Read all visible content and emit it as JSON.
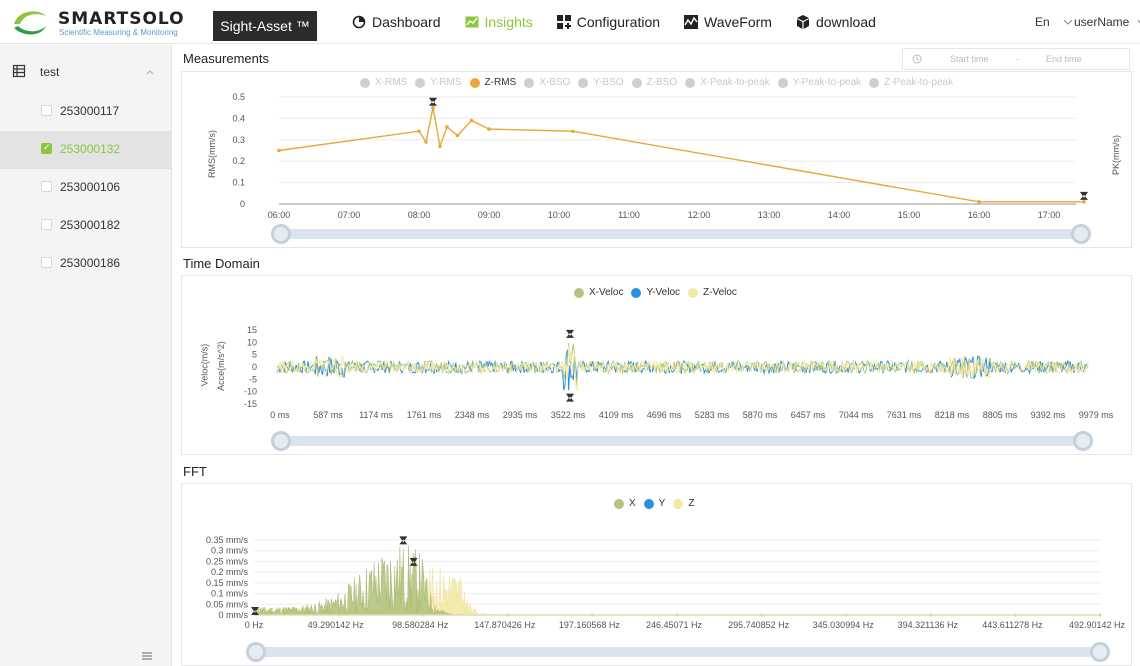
{
  "header": {
    "brand": "SMARTSOLO",
    "tagline": "Scientific Measuring & Monitoring",
    "product": "Sight-Asset ™",
    "nav": [
      {
        "label": "Dashboard",
        "icon": "pie-chart-icon"
      },
      {
        "label": "Insights",
        "icon": "area-chart-icon",
        "active": true
      },
      {
        "label": "Configuration",
        "icon": "grid-icon"
      },
      {
        "label": "WaveForm",
        "icon": "waveform-icon"
      },
      {
        "label": "download",
        "icon": "cube-icon"
      }
    ],
    "language": "En",
    "username": "userName"
  },
  "sidebar": {
    "group_label": "test",
    "devices": [
      {
        "label": "253000117",
        "checked": false
      },
      {
        "label": "253000132",
        "checked": true
      },
      {
        "label": "253000106",
        "checked": false
      },
      {
        "label": "253000182",
        "checked": false
      },
      {
        "label": "253000186",
        "checked": false
      }
    ]
  },
  "colors": {
    "accent": "#8cc63f",
    "zrms": "#e8a83a",
    "x": "#b4c37f",
    "y": "#2b8fe0",
    "z": "#f3e9a6"
  },
  "measurements": {
    "title": "Measurements",
    "start_placeholder": "Start time",
    "end_placeholder": "End time",
    "range_separator": "-",
    "legend": [
      "X-RMS",
      "Y-RMS",
      "Z-RMS",
      "X-BSO",
      "Y-BSO",
      "Z-BSO",
      "X-Peak-to-peak",
      "Y-Peak-to-peak",
      "Z-Peak-to-peak"
    ],
    "legend_active": "Z-RMS",
    "ylabel_left": "RMS(mm/s)",
    "ylabel_right": "PK(mm/s)"
  },
  "time_domain": {
    "title": "Time Domain",
    "legend": [
      "X-Veloc",
      "Y-Veloc",
      "Z-Veloc"
    ],
    "ylabel1": "Veloc(m/s)",
    "ylabel2": "Acce(m/s^2)"
  },
  "fft": {
    "title": "FFT",
    "legend": [
      "X",
      "Y",
      "Z"
    ]
  },
  "chart_data": [
    {
      "type": "line",
      "title": "Measurements",
      "ylabel": "RMS(mm/s)",
      "ylabel_right": "PK(mm/s)",
      "x_ticks": [
        "06:00",
        "07:00",
        "08:00",
        "09:00",
        "10:00",
        "11:00",
        "12:00",
        "13:00",
        "14:00",
        "15:00",
        "16:00",
        "17:00"
      ],
      "y_ticks": [
        "0",
        "0.1",
        "0.2",
        "0.3",
        "0.4",
        "0.5"
      ],
      "ylim": [
        0,
        0.5
      ],
      "series": [
        {
          "name": "Z-RMS",
          "x_hours": [
            6.0,
            8.0,
            8.1,
            8.2,
            8.3,
            8.4,
            8.55,
            8.75,
            9.0,
            10.2,
            16.0,
            17.5
          ],
          "values": [
            0.25,
            0.34,
            0.29,
            0.45,
            0.27,
            0.36,
            0.32,
            0.39,
            0.35,
            0.34,
            0.01,
            0.01
          ]
        }
      ],
      "markers": [
        {
          "x_hours": 8.2,
          "value": 0.45
        },
        {
          "x_hours": 17.5,
          "value": 0.01
        }
      ]
    },
    {
      "type": "line",
      "title": "Time Domain",
      "ylabel": "Veloc(m/s)",
      "x_ticks": [
        "0 ms",
        "587 ms",
        "1174 ms",
        "1761 ms",
        "2348 ms",
        "2935 ms",
        "3522 ms",
        "4109 ms",
        "4696 ms",
        "5283 ms",
        "5870 ms",
        "6457 ms",
        "7044 ms",
        "7631 ms",
        "8218 ms",
        "8805 ms",
        "9392 ms",
        "9979 ms"
      ],
      "y_ticks": [
        "15",
        "10",
        "5",
        "0",
        "-5",
        "-10",
        "-15"
      ],
      "ylim": [
        -15,
        15
      ],
      "series": [
        {
          "name": "X-Veloc",
          "amplitude": 2.5,
          "burst_at_ms": 3522,
          "burst_amplitude": 10
        },
        {
          "name": "Y-Veloc",
          "amplitude": 2.5,
          "burst_at_ms": 3522,
          "burst_amplitude": 10
        },
        {
          "name": "Z-Veloc",
          "amplitude": 2.5,
          "burst_at_ms": 3522,
          "burst_amplitude": 10
        }
      ]
    },
    {
      "type": "area",
      "title": "FFT",
      "x_ticks": [
        "0 Hz",
        "49.290142 Hz",
        "98.580284 Hz",
        "147.870426 Hz",
        "197.160568 Hz",
        "246.45071 Hz",
        "295.740852 Hz",
        "345.030994 Hz",
        "394.321136 Hz",
        "443.611278 Hz",
        "492.90142 Hz"
      ],
      "y_ticks": [
        "0 mm/s",
        "0.05 mm/s",
        "0.1 mm/s",
        "0.15 mm/s",
        "0.2 mm/s",
        "0.25 mm/s",
        "0.3 mm/s",
        "0.35 mm/s"
      ],
      "ylim": [
        0,
        0.35
      ],
      "series": [
        {
          "name": "X",
          "peak_hz": 85,
          "peak_value": 0.3
        },
        {
          "name": "Y",
          "peak_hz": 0,
          "peak_value": 0.02
        },
        {
          "name": "Z",
          "peak_hz": 110,
          "peak_value": 0.2
        }
      ],
      "markers": [
        {
          "hz": 87,
          "value": 0.32
        },
        {
          "hz": 93,
          "value": 0.22
        }
      ]
    }
  ]
}
